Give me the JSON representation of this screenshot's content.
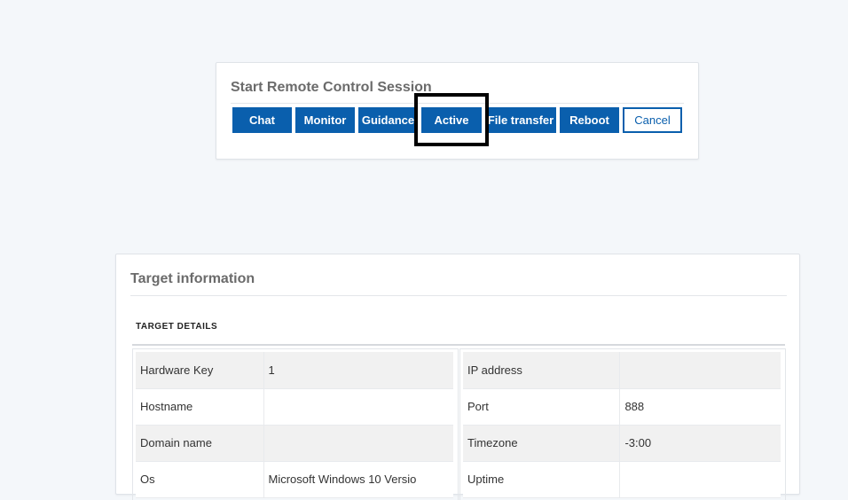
{
  "session": {
    "title": "Start Remote Control Session",
    "buttons": {
      "chat": "Chat",
      "monitor": "Monitor",
      "guidance": "Guidance",
      "active": "Active",
      "file_transfer": "File transfer",
      "reboot": "Reboot",
      "cancel": "Cancel"
    }
  },
  "target": {
    "title": "Target information",
    "section_label": "TARGET DETAILS",
    "left_rows": [
      {
        "label": "Hardware Key",
        "value": "1"
      },
      {
        "label": "Hostname",
        "value": ""
      },
      {
        "label": "Domain name",
        "value": ""
      },
      {
        "label": "Os",
        "value": "Microsoft Windows 10 Versio"
      }
    ],
    "right_rows": [
      {
        "label": "IP address",
        "value": ""
      },
      {
        "label": "Port",
        "value": "888"
      },
      {
        "label": "Timezone",
        "value": "-3:00"
      },
      {
        "label": "Uptime",
        "value": ""
      }
    ]
  },
  "colors": {
    "primary": "#0a5fad",
    "background": "#f4f7fa",
    "highlight": "#000000"
  }
}
